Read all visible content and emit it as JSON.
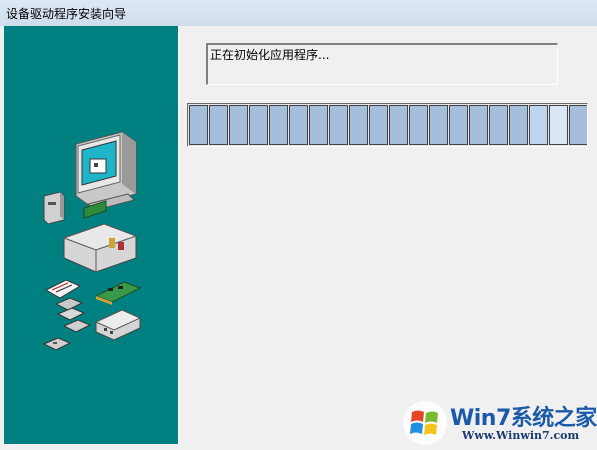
{
  "window": {
    "title": "设备驱动程序安装向导"
  },
  "status": {
    "message": "正在初始化应用程序..."
  },
  "progress": {
    "total_segments": 20,
    "filled_segments": 20
  },
  "watermark": {
    "brand": "Win7系统之家",
    "url": "Www.Winwin7.com"
  },
  "colors": {
    "left_panel": "#008080",
    "progress_block": "#a5bedc",
    "background": "#f0f0f0"
  },
  "icons": [
    "computer-monitor-icon",
    "pc-tower-icon",
    "open-case-icon",
    "keyboard-icon",
    "floppy-disk-icon",
    "circuit-card-icon",
    "network-hub-icon",
    "windows-logo-icon"
  ]
}
